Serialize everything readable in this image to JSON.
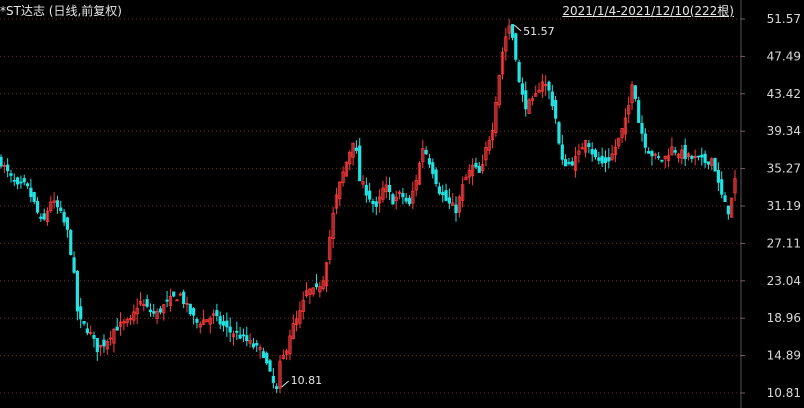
{
  "header": {
    "title": "*ST达志 (日线,前复权)",
    "range": "2021/1/4-2021/12/10(222根)"
  },
  "colors": {
    "background": "#000000",
    "up": "#ff3b3b",
    "down": "#22e3e3",
    "grid": "#7a2a2a",
    "axis_text": "#d8d8d8"
  },
  "chart_data": {
    "type": "candlestick",
    "title": "*ST达志 (日线,前复权)",
    "period": "2021/1/4-2021/12/10",
    "bar_count": 222,
    "ylim": [
      10.81,
      51.57
    ],
    "y_ticks": [
      "51.57",
      "47.49",
      "43.42",
      "39.34",
      "35.27",
      "31.19",
      "27.11",
      "23.04",
      "18.96",
      "14.89",
      "10.81"
    ],
    "max_label": "51.57",
    "min_label": "10.81",
    "close_path": [
      [
        0,
        36.0
      ],
      [
        3,
        34.5
      ],
      [
        6,
        33.2
      ],
      [
        9,
        33.5
      ],
      [
        12,
        31.5
      ],
      [
        15,
        29.0
      ],
      [
        18,
        31.8
      ],
      [
        21,
        30.8
      ],
      [
        24,
        28.5
      ],
      [
        26,
        25.0
      ],
      [
        28,
        18.8
      ],
      [
        30,
        18.2
      ],
      [
        32,
        17.5
      ],
      [
        35,
        15.6
      ],
      [
        38,
        16.4
      ],
      [
        41,
        17.8
      ],
      [
        44,
        18.3
      ],
      [
        47,
        18.6
      ],
      [
        50,
        20.8
      ],
      [
        53,
        20.0
      ],
      [
        56,
        19.3
      ],
      [
        59,
        20.3
      ],
      [
        62,
        21.1
      ],
      [
        65,
        21.5
      ],
      [
        68,
        19.8
      ],
      [
        71,
        18.5
      ],
      [
        74,
        18.8
      ],
      [
        77,
        19.2
      ],
      [
        80,
        18.3
      ],
      [
        83,
        17.5
      ],
      [
        86,
        17.2
      ],
      [
        89,
        16.5
      ],
      [
        92,
        15.8
      ],
      [
        95,
        15.2
      ],
      [
        97,
        13.2
      ],
      [
        99,
        11.6
      ],
      [
        100,
        11.0
      ],
      [
        101,
        13.8
      ],
      [
        103,
        15.2
      ],
      [
        105,
        17.6
      ],
      [
        108,
        19.2
      ],
      [
        111,
        22.0
      ],
      [
        114,
        21.8
      ],
      [
        117,
        23.5
      ],
      [
        119,
        27.5
      ],
      [
        121,
        31.5
      ],
      [
        123,
        33.8
      ],
      [
        126,
        36.8
      ],
      [
        128,
        38.8
      ],
      [
        130,
        34.0
      ],
      [
        133,
        32.5
      ],
      [
        136,
        30.8
      ],
      [
        139,
        33.5
      ],
      [
        142,
        31.8
      ],
      [
        145,
        32.5
      ],
      [
        148,
        31.2
      ],
      [
        151,
        34.8
      ],
      [
        153,
        37.8
      ],
      [
        156,
        35.5
      ],
      [
        159,
        32.8
      ],
      [
        162,
        31.5
      ],
      [
        165,
        30.8
      ],
      [
        168,
        34.0
      ],
      [
        171,
        35.5
      ],
      [
        174,
        34.5
      ],
      [
        176,
        37.8
      ],
      [
        178,
        39.5
      ],
      [
        180,
        44.5
      ],
      [
        182,
        48.5
      ],
      [
        184,
        51.0
      ],
      [
        186,
        49.0
      ],
      [
        188,
        44.0
      ],
      [
        190,
        42.2
      ],
      [
        193,
        42.5
      ],
      [
        196,
        45.0
      ],
      [
        199,
        43.5
      ],
      [
        201,
        40.8
      ],
      [
        203,
        36.0
      ],
      [
        206,
        35.8
      ],
      [
        209,
        36.5
      ],
      [
        212,
        38.8
      ],
      [
        215,
        36.5
      ],
      [
        218,
        35.8
      ],
      [
        221,
        36.5
      ],
      [
        224,
        38.5
      ],
      [
        227,
        41.0
      ],
      [
        229,
        45.5
      ],
      [
        231,
        40.5
      ],
      [
        234,
        37.5
      ],
      [
        237,
        36.5
      ],
      [
        240,
        36.2
      ],
      [
        243,
        37.5
      ],
      [
        246,
        37.0
      ],
      [
        249,
        36.5
      ],
      [
        252,
        36.3
      ],
      [
        255,
        36.0
      ],
      [
        258,
        36.4
      ],
      [
        260,
        33.5
      ],
      [
        262,
        31.5
      ],
      [
        264,
        30.5
      ],
      [
        266,
        34.0
      ]
    ]
  }
}
